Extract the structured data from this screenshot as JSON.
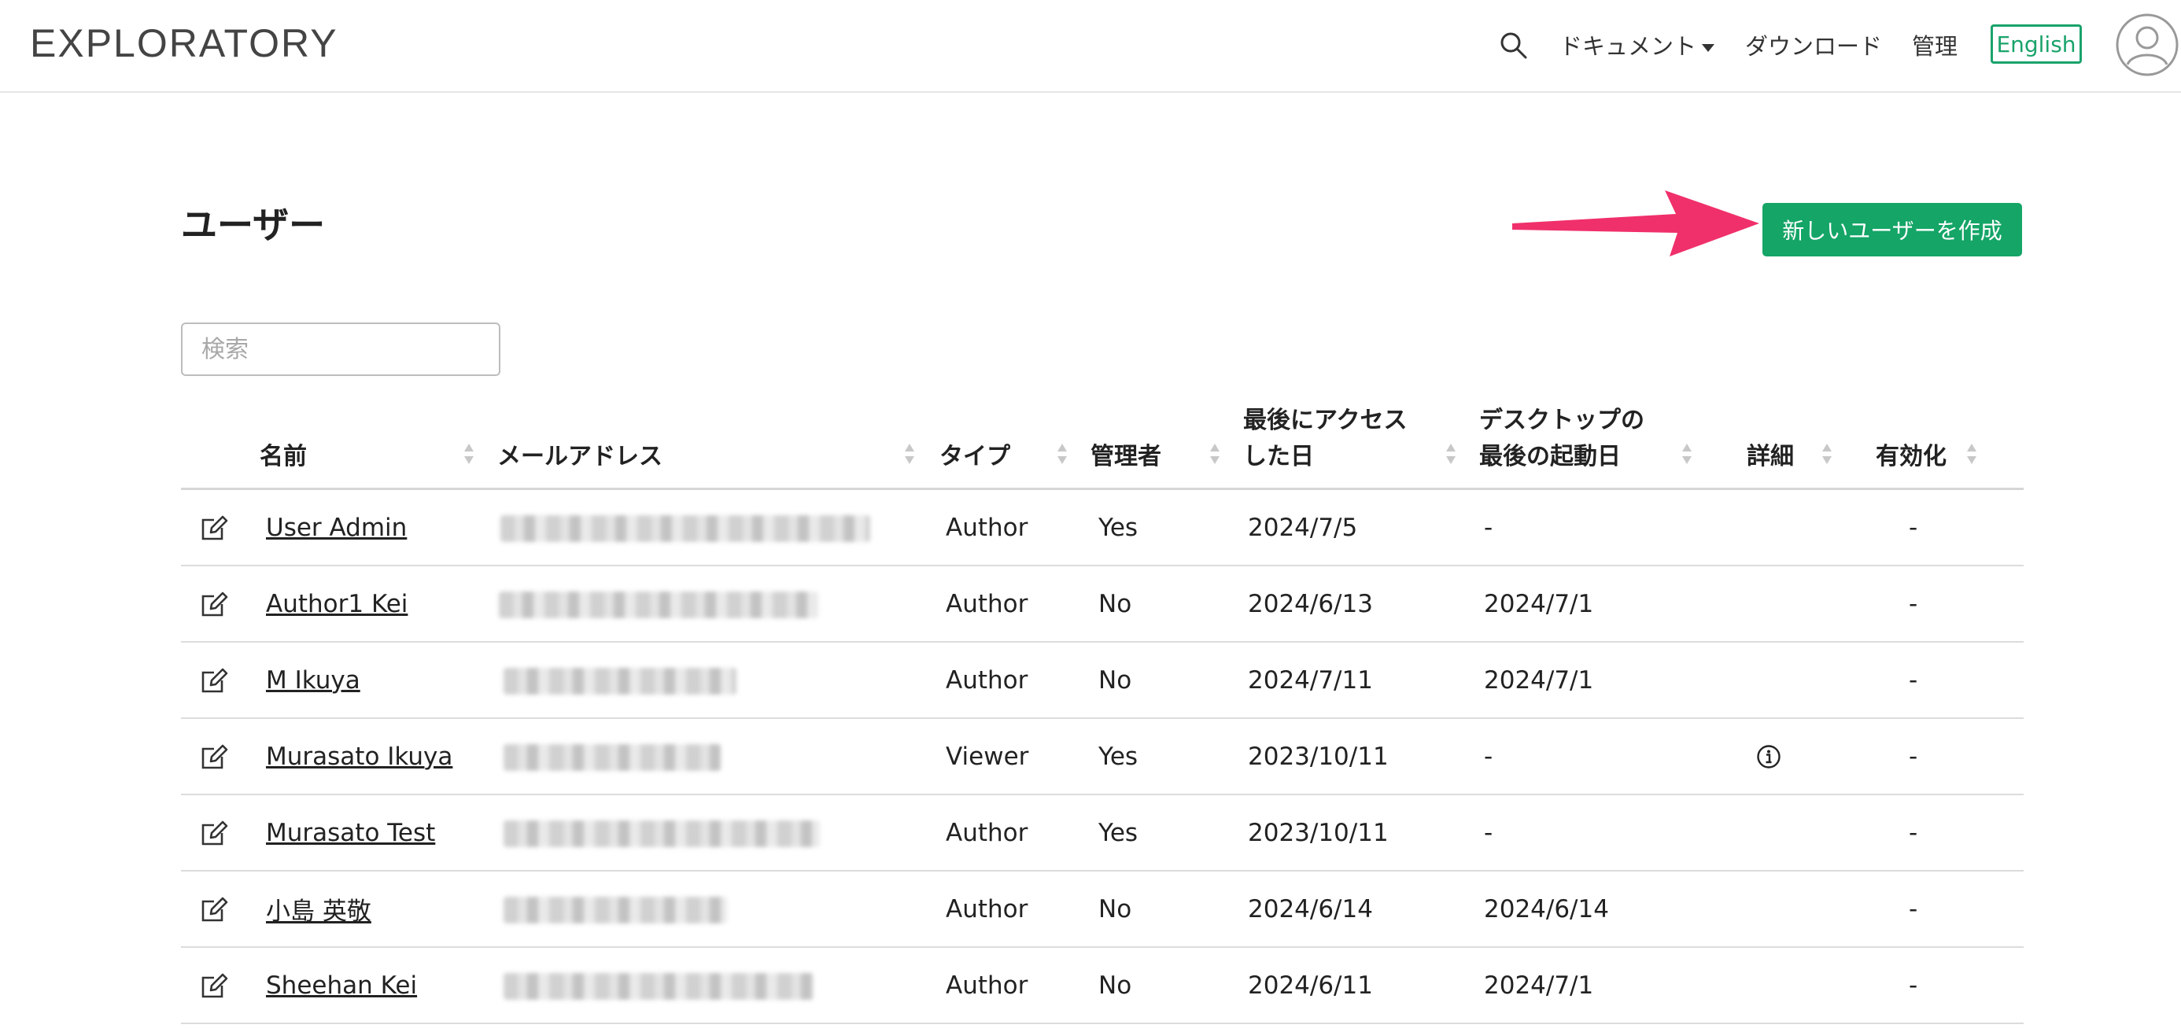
{
  "nav": {
    "logo": "EXPLORATORY",
    "documents": "ドキュメント",
    "download": "ダウンロード",
    "admin": "管理",
    "language": "English"
  },
  "page": {
    "title": "ユーザー",
    "create_button": "新しいユーザーを作成",
    "search_placeholder": "検索"
  },
  "table": {
    "headers": {
      "name": "名前",
      "email": "メールアドレス",
      "type": "タイプ",
      "admin": "管理者",
      "last_access_1": "最後にアクセス",
      "last_access_2": "した日",
      "desktop_1": "デスクトップの",
      "desktop_2": "最後の起動日",
      "details": "詳細",
      "enabled": "有効化"
    },
    "rows": [
      {
        "name": "User Admin",
        "type": "Author",
        "admin": "Yes",
        "last_access": "2024/7/5",
        "desktop": "-",
        "enabled": "-"
      },
      {
        "name": "Author1 Kei",
        "type": "Author",
        "admin": "No",
        "last_access": "2024/6/13",
        "desktop": "2024/7/1",
        "enabled": "-"
      },
      {
        "name": "M Ikuya",
        "type": "Author",
        "admin": "No",
        "last_access": "2024/7/11",
        "desktop": "2024/7/1",
        "enabled": "-"
      },
      {
        "name": "Murasato Ikuya",
        "type": "Viewer",
        "admin": "Yes",
        "last_access": "2023/10/11",
        "desktop": "-",
        "enabled": "-"
      },
      {
        "name": "Murasato Test",
        "type": "Author",
        "admin": "Yes",
        "last_access": "2023/10/11",
        "desktop": "-",
        "enabled": "-"
      },
      {
        "name": "小島 英敬",
        "type": "Author",
        "admin": "No",
        "last_access": "2024/6/14",
        "desktop": "2024/6/14",
        "enabled": "-"
      },
      {
        "name": "Sheehan Kei",
        "type": "Author",
        "admin": "No",
        "last_access": "2024/6/11",
        "desktop": "2024/7/1",
        "enabled": "-"
      }
    ]
  },
  "colors": {
    "accent": "#14a567",
    "arrow": "#f0306b"
  }
}
